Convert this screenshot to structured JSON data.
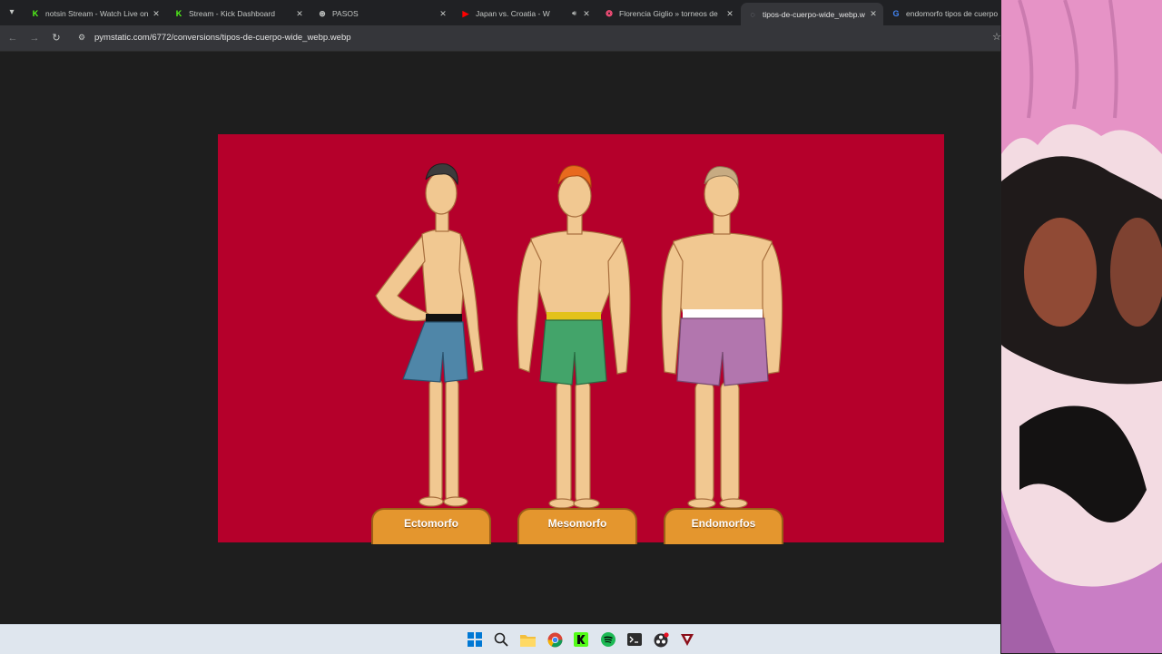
{
  "tabs": [
    {
      "title": "notsin Stream - Watch Live on",
      "favicon": "kick-icon",
      "color": "#53fc18",
      "active": false
    },
    {
      "title": "Stream - Kick Dashboard",
      "favicon": "kick-icon",
      "color": "#53fc18",
      "active": false
    },
    {
      "title": "PASOS",
      "favicon": "globe-icon",
      "color": "#c4c7c5",
      "active": false
    },
    {
      "title": "Japan vs. Croatia - W",
      "favicon": "youtube-icon",
      "color": "#ff0000",
      "active": false,
      "audio": true
    },
    {
      "title": "Florencia Giglio » torneos de",
      "favicon": "spiral-icon",
      "color": "#ff4f7b",
      "active": false
    },
    {
      "title": "tipos-de-cuerpo-wide_webp.w",
      "favicon": "page-icon",
      "color": "#9aa0a6",
      "active": true
    },
    {
      "title": "endomorfo tipos de cuerpo",
      "favicon": "google-icon",
      "color": "#4285f4",
      "active": false
    }
  ],
  "address_bar": {
    "url": "pymstatic.com/6772/conversions/tipos-de-cuerpo-wide_webp.webp"
  },
  "figure": {
    "background": "#b5002b",
    "labels": [
      "Ectomorfo",
      "Mesomorfo",
      "Endomorfos"
    ],
    "shorts_colors": [
      "#4f86a8",
      "#43a46a",
      "#b276ae"
    ],
    "waistband_colors": [
      "#111111",
      "#e3c21a",
      "#ffffff"
    ],
    "hair_colors": [
      "#3c3c3c",
      "#e86a1e",
      "#c7ab82"
    ]
  },
  "taskbar": {
    "icons": [
      "windows-start-icon",
      "search-icon",
      "file-explorer-icon",
      "chrome-icon",
      "kick-icon",
      "spotify-icon",
      "terminal-icon",
      "obs-icon",
      "app-icon"
    ]
  }
}
